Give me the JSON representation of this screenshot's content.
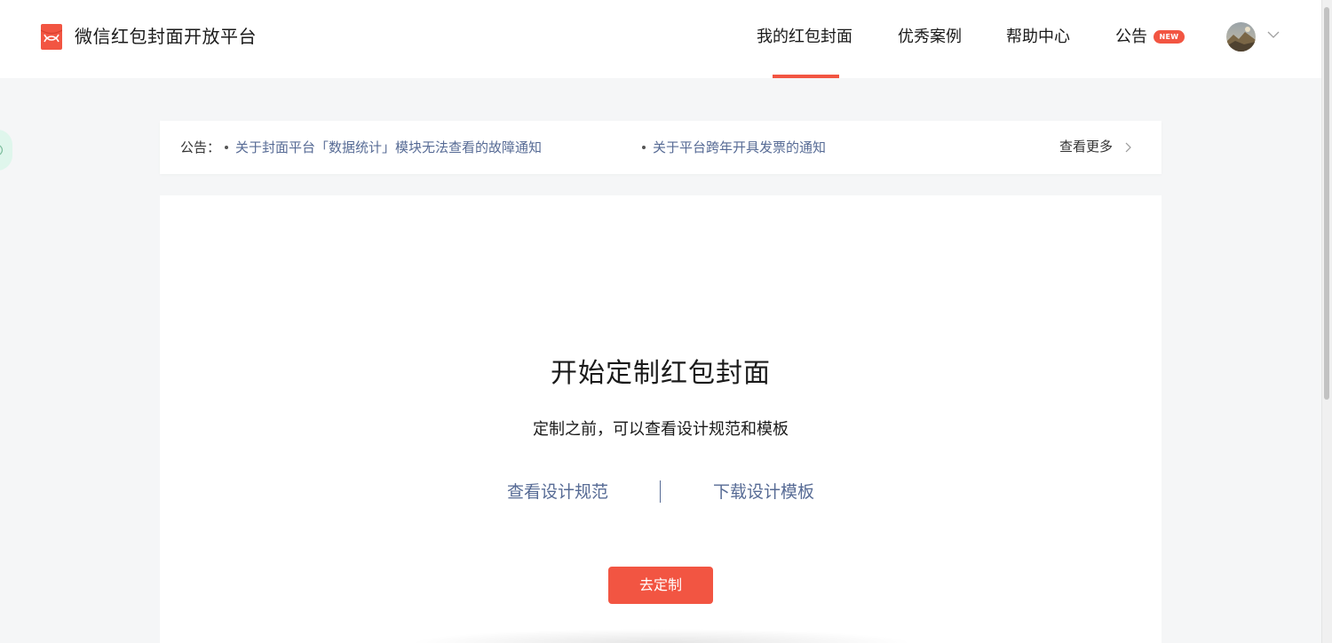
{
  "brand": {
    "name": "微信红包封面开放平台",
    "accent_color": "#f25542"
  },
  "nav": {
    "items": [
      {
        "label": "我的红包封面",
        "active": true
      },
      {
        "label": "优秀案例",
        "active": false
      },
      {
        "label": "帮助中心",
        "active": false
      },
      {
        "label": "公告",
        "active": false
      }
    ],
    "new_badge": "NEW"
  },
  "user": {
    "avatar_icon": "avatar-icon",
    "menu_icon": "chevron-down-icon"
  },
  "notice": {
    "label": "公告：",
    "items": [
      "关于封面平台「数据统计」模块无法查看的故障通知",
      "关于平台跨年开具发票的通知"
    ],
    "see_more": "查看更多",
    "link_color": "#576b95"
  },
  "main": {
    "title": "开始定制红包封面",
    "subtitle": "定制之前，可以查看设计规范和模板",
    "links": [
      "查看设计规范",
      "下载设计模板"
    ],
    "cta": "去定制"
  }
}
